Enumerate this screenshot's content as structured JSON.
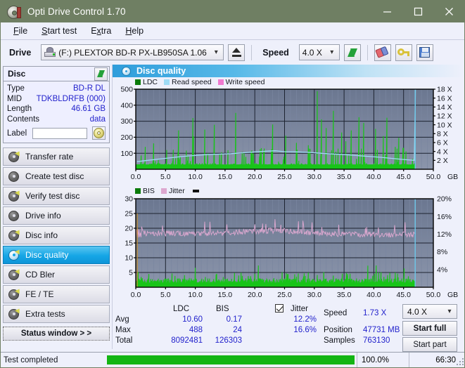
{
  "window": {
    "title": "Opti Drive Control 1.70",
    "icon": "disc-icon",
    "controls": {
      "minimize": "minimize-icon",
      "maximize": "maximize-icon",
      "close": "close-icon"
    }
  },
  "menu": {
    "items": [
      "File",
      "Start test",
      "Extra",
      "Help"
    ]
  },
  "toolbar": {
    "drive_label": "Drive",
    "drive_value": "(F:)   PLEXTOR BD-R  PX-LB950SA 1.06",
    "eject_icon": "eject-icon",
    "speed_label": "Speed",
    "speed_value": "4.0 X",
    "refresh_icon": "refresh-icon",
    "erase_icon": "eraser-icon",
    "key_icon": "key-icon",
    "save_icon": "save-icon"
  },
  "disc_panel": {
    "title": "Disc",
    "refresh_icon": "refresh-icon",
    "rows": [
      {
        "key": "Type",
        "value": "BD-R DL"
      },
      {
        "key": "MID",
        "value": "TDKBLDRFB (000)"
      },
      {
        "key": "Length",
        "value": "46.61 GB"
      },
      {
        "key": "Contents",
        "value": "data"
      }
    ],
    "label_key": "Label",
    "label_value": "",
    "label_placeholder": "",
    "disc_button_icon": "disc-icon"
  },
  "sidebar": {
    "items": [
      {
        "label": "Transfer rate",
        "selected": false
      },
      {
        "label": "Create test disc",
        "selected": false
      },
      {
        "label": "Verify test disc",
        "selected": false
      },
      {
        "label": "Drive info",
        "selected": false
      },
      {
        "label": "Disc info",
        "selected": false
      },
      {
        "label": "Disc quality",
        "selected": true
      },
      {
        "label": "CD Bler",
        "selected": false
      },
      {
        "label": "FE / TE",
        "selected": false
      },
      {
        "label": "Extra tests",
        "selected": false
      }
    ],
    "status_window_button": "Status window > >"
  },
  "panel": {
    "title": "Disc quality",
    "icon": "disc-quality-icon"
  },
  "stats": {
    "col_ldc": "LDC",
    "col_bis": "BIS",
    "jitter_label": "Jitter",
    "jitter_checked": true,
    "rows": [
      {
        "name": "Avg",
        "ldc": "10.60",
        "bis": "0.17",
        "jitter": "12.2%"
      },
      {
        "name": "Max",
        "ldc": "488",
        "bis": "24",
        "jitter": "16.6%"
      },
      {
        "name": "Total",
        "ldc": "8092481",
        "bis": "126303",
        "jitter": ""
      }
    ],
    "speed_label": "Speed",
    "speed_value": "1.73 X",
    "position_label": "Position",
    "position_value": "47731 MB",
    "samples_label": "Samples",
    "samples_value": "763130",
    "speed_select": "4.0 X",
    "start_full": "Start full",
    "start_part": "Start part"
  },
  "statusbar": {
    "text": "Test completed",
    "progress_pct": "100.0%",
    "progress_value": 100,
    "time": "66:30"
  },
  "colors": {
    "title_bar": "#6f7f63",
    "ldc_green": "#18c418",
    "read_speed_blue": "#9fdcf5",
    "write_speed_pink": "#f07ad0",
    "bis_green": "#18c418",
    "jitter_pink": "#dda8d0",
    "plot_bg_top": "#6b7790",
    "plot_bg_bottom": "#8b95ab",
    "accent_blue": "#2222cc",
    "progress_green": "#13b513",
    "selection_blue": "#15a6e6"
  },
  "chart_data": [
    {
      "type": "line",
      "id": "ldc-chart",
      "title": "Disc quality",
      "legend": [
        {
          "name": "LDC",
          "color": "#0a7a0a"
        },
        {
          "name": "Read speed",
          "color": "#9fdcf5"
        },
        {
          "name": "Write speed",
          "color": "#f07ad0"
        }
      ],
      "legend_position": "top-left",
      "grid": true,
      "xlabel": "GB",
      "x_ticks": [
        "0.0",
        "5.0",
        "10.0",
        "15.0",
        "20.0",
        "25.0",
        "30.0",
        "35.0",
        "40.0",
        "45.0",
        "50.0"
      ],
      "xlim": [
        0,
        50
      ],
      "ylabel_left": "LDC",
      "y_ticks_left": [
        "100",
        "200",
        "300",
        "400",
        "500"
      ],
      "ylim_left": [
        0,
        500
      ],
      "ylabel_right": "Speed",
      "y_ticks_right": [
        "2 X",
        "4 X",
        "6 X",
        "8 X",
        "10 X",
        "12 X",
        "14 X",
        "16 X",
        "18 X"
      ],
      "ylim_right": [
        0,
        18
      ],
      "series": [
        {
          "name": "Read speed",
          "color": "#9fdcf5",
          "axis": "right",
          "x": [
            0.2,
            2,
            4,
            6,
            8,
            10,
            12,
            14,
            16,
            18,
            20,
            22,
            23.4,
            25,
            27,
            29,
            31,
            33,
            35,
            37,
            39,
            41,
            43,
            45,
            46.8,
            46.9,
            47.0
          ],
          "y": [
            1.7,
            2.0,
            2.3,
            2.6,
            2.9,
            3.1,
            3.3,
            3.4,
            3.5,
            3.7,
            3.9,
            4.05,
            4.15,
            3.95,
            3.9,
            3.8,
            3.6,
            3.45,
            3.3,
            3.1,
            2.9,
            2.7,
            2.45,
            2.2,
            2.0,
            10.0,
            18.0
          ]
        },
        {
          "name": "LDC",
          "color": "#18c418",
          "axis": "left",
          "description": "dense green spike field spanning 0 to 47 GB, baseline band ~15-40, frequent spikes 100-350, maximum spike 488 near 30.5 GB",
          "baseline_range": [
            12,
            45
          ],
          "max_value": 488,
          "max_position_gb": 30.5,
          "end_position_gb": 47
        }
      ]
    },
    {
      "type": "line",
      "id": "bis-chart",
      "legend": [
        {
          "name": "BIS",
          "color": "#0a7a0a"
        },
        {
          "name": "Jitter",
          "color": "#dda8d0"
        }
      ],
      "legend_position": "top-left",
      "grid": true,
      "xlabel": "GB",
      "x_ticks": [
        "0.0",
        "5.0",
        "10.0",
        "15.0",
        "20.0",
        "25.0",
        "30.0",
        "35.0",
        "40.0",
        "45.0",
        "50.0"
      ],
      "xlim": [
        0,
        50
      ],
      "ylabel_left": "BIS",
      "y_ticks_left": [
        "5",
        "10",
        "15",
        "20",
        "25",
        "30"
      ],
      "ylim_left": [
        0,
        30
      ],
      "ylabel_right": "Jitter",
      "y_ticks_right": [
        "4%",
        "8%",
        "12%",
        "16%",
        "20%"
      ],
      "ylim_right": [
        0,
        20
      ],
      "series": [
        {
          "name": "Jitter",
          "color": "#dda8d0",
          "axis": "right",
          "description": "noisy band averaging about 12.2%, ranging roughly 11% to 14%, peaks near 16.6% around 23-24 GB, ends at 47 GB",
          "mean_pct": 12.2,
          "max_pct": 16.6,
          "end_position_gb": 47
        },
        {
          "name": "BIS",
          "color": "#18c418",
          "axis": "left",
          "description": "dense low green band with baseline about 2, frequent spikes to 4-5, a few spikes to 7, maximum 24",
          "baseline_range": [
            1,
            3
          ],
          "max_value": 24,
          "end_position_gb": 47
        }
      ]
    }
  ]
}
